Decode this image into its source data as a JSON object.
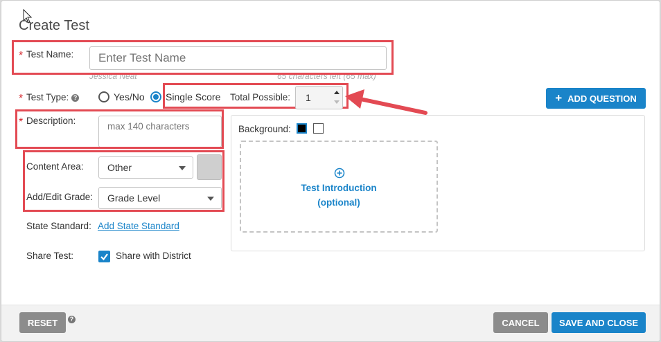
{
  "modal": {
    "title": "Create Test"
  },
  "test_name": {
    "label": "Test Name:",
    "required": "*",
    "placeholder": "Enter Test Name",
    "author": "Jessica Neat",
    "chars_left": "65 characters left (65 max)"
  },
  "test_type": {
    "label": "Test Type:",
    "required": "*",
    "help": "?",
    "options": [
      "Yes/No",
      "Single Score"
    ],
    "selected": "Single Score"
  },
  "total_possible": {
    "label": "Total Possible:",
    "value": "1"
  },
  "add_question": {
    "label": "ADD QUESTION",
    "icon": "plus-icon"
  },
  "description": {
    "label": "Description:",
    "required": "*",
    "placeholder": "max 140 characters"
  },
  "content_area": {
    "label": "Content Area:",
    "value": "Other"
  },
  "grade": {
    "label": "Add/Edit Grade:",
    "value": "Grade Level"
  },
  "state_standard": {
    "label": "State Standard:",
    "link": "Add State Standard"
  },
  "share": {
    "label": "Share Test:",
    "option": "Share with District",
    "checked": true
  },
  "background": {
    "label": "Background:",
    "swatches": [
      "#000000",
      "#ffffff"
    ]
  },
  "intro": {
    "line1": "Test Introduction",
    "line2": "(optional)",
    "icon": "plus-circle-icon"
  },
  "footer": {
    "reset": "RESET",
    "help": "?",
    "cancel": "CANCEL",
    "save_close": "SAVE AND CLOSE"
  },
  "colors": {
    "accent": "#1a84c9",
    "annotation_red": "#e34a53",
    "required_red": "#d4242a",
    "gray_button": "#8c8c8c"
  }
}
